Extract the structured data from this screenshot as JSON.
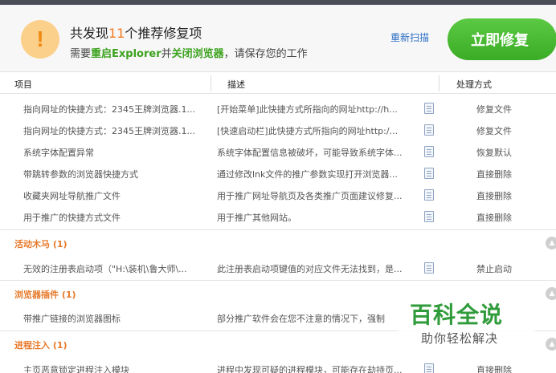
{
  "header": {
    "title_prefix": "共发现",
    "title_count": "11",
    "title_suffix": "个推荐修复项",
    "sub_1": "需要",
    "sub_restart": "重启Explorer",
    "sub_2": "并",
    "sub_close": "关闭浏览器",
    "sub_3": "，请保存您的工作",
    "rescan": "重新扫描",
    "repair": "立即修复"
  },
  "columns": {
    "item": "项目",
    "desc": "描述",
    "action": "处理方式"
  },
  "groups": [
    {
      "title": "",
      "rows": [
        {
          "item": "指向网址的快捷方式：2345王牌浏览器.1...",
          "desc": "[开始菜单]此快捷方式所指向的网址http://h...",
          "action": "修复文件"
        },
        {
          "item": "指向网址的快捷方式：2345王牌浏览器.1...",
          "desc": "[快速启动栏]此快捷方式所指向的网址http:/...",
          "action": "修复文件"
        },
        {
          "item": "系统字体配置异常",
          "desc": "系统字体配置信息被破坏，可能导致系统字体...",
          "action": "恢复默认"
        },
        {
          "item": "带跳转参数的浏览器快捷方式",
          "desc": "通过修改lnk文件的推广参数实现打开浏览器...",
          "action": "直接删除"
        },
        {
          "item": "收藏夹网址导航推广文件",
          "desc": "用于推广网址导航页及各类推广页面建议修复...",
          "action": "直接删除"
        },
        {
          "item": "用于推广的快捷方式文件",
          "desc": "用于推广其他网站。",
          "action": "直接删除"
        }
      ]
    },
    {
      "title": "活动木马 (1)",
      "rows": [
        {
          "item": "无效的注册表启动项（\"H:\\装机\\鲁大师\\...",
          "desc": "此注册表启动项键值的对应文件无法找到，是...",
          "action": "禁止启动"
        }
      ]
    },
    {
      "title": "浏览器插件 (1)",
      "rows": [
        {
          "item": "带推广链接的浏览器图标",
          "desc": "部分推广软件会在您不注意的情况下，强制",
          "action": ""
        }
      ]
    },
    {
      "title": "进程注入 (1)",
      "rows": [
        {
          "item": "主页恶意锁定进程注入模块",
          "desc": "进程中发现可疑的进程模块，可能存在劫持页...",
          "action": "直接删除"
        }
      ]
    }
  ],
  "watermark": {
    "title": "百科全说",
    "sub": "助你轻松解决"
  },
  "colors": {
    "accent_orange": "#f37a22",
    "accent_green": "#3ca21e",
    "button_green": "#4bb834",
    "link_blue": "#2b6ec4"
  }
}
